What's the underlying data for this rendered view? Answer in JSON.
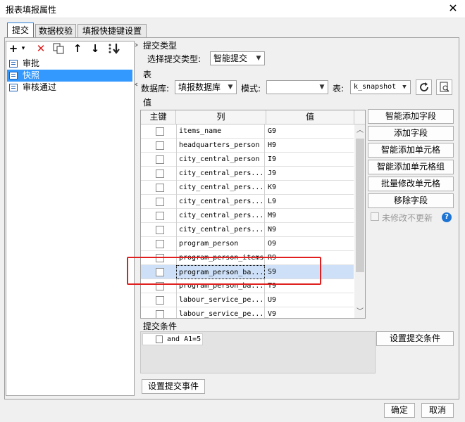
{
  "window": {
    "title": "报表填报属性",
    "close_glyph": "✕"
  },
  "tabs": [
    {
      "label": "提交"
    },
    {
      "label": "数据校验"
    },
    {
      "label": "填报快捷键设置"
    }
  ],
  "toolbar": {
    "add": "+",
    "add_arrow": "▾",
    "delete": "✕",
    "up": "↑",
    "down": "↓"
  },
  "tree": {
    "items": [
      {
        "label": "审批"
      },
      {
        "label": "快照"
      },
      {
        "label": "审核通过"
      }
    ]
  },
  "submit_type": {
    "section": "提交类型",
    "label": "选择提交类型:",
    "value": "智能提交"
  },
  "table_section": {
    "section": "表",
    "db_label": "数据库:",
    "db_value": "填报数据库",
    "schema_label": "模式:",
    "schema_value": "",
    "table_label": "表:",
    "table_value": "k_snapshot"
  },
  "values_section": {
    "section": "值",
    "columns": [
      "主键",
      "列",
      "值"
    ],
    "rows": [
      {
        "column": "items_name",
        "value": "G9"
      },
      {
        "column": "headquarters_person",
        "value": "H9"
      },
      {
        "column": "city_central_person",
        "value": "I9"
      },
      {
        "column": "city_central_pers...",
        "value": "J9"
      },
      {
        "column": "city_central_pers...",
        "value": "K9"
      },
      {
        "column": "city_central_pers...",
        "value": "L9"
      },
      {
        "column": "city_central_pers...",
        "value": "M9"
      },
      {
        "column": "city_central_pers...",
        "value": "N9"
      },
      {
        "column": "program_person",
        "value": "O9"
      },
      {
        "column": "program_person_items",
        "value": "R9"
      },
      {
        "column": "program_person_ba...",
        "value": "S9"
      },
      {
        "column": "program_person_ba...",
        "value": "T9"
      },
      {
        "column": "labour_service_pe...",
        "value": "U9"
      },
      {
        "column": "labour_service_pe...",
        "value": "V9"
      }
    ],
    "selected_row": 10
  },
  "side_buttons": {
    "smart_add_field": "智能添加字段",
    "add_field": "添加字段",
    "smart_add_cell": "智能添加单元格",
    "smart_add_cell_group": "智能添加单元格组",
    "batch_modify_cell": "批量修改单元格",
    "remove_field": "移除字段",
    "no_update_if_unchanged": "未修改不更新",
    "help": "?"
  },
  "condition": {
    "section": "提交条件",
    "expression": "and A1=5",
    "set_button": "设置提交条件"
  },
  "event_button": "设置提交事件",
  "footer": {
    "ok": "确定",
    "cancel": "取消"
  }
}
